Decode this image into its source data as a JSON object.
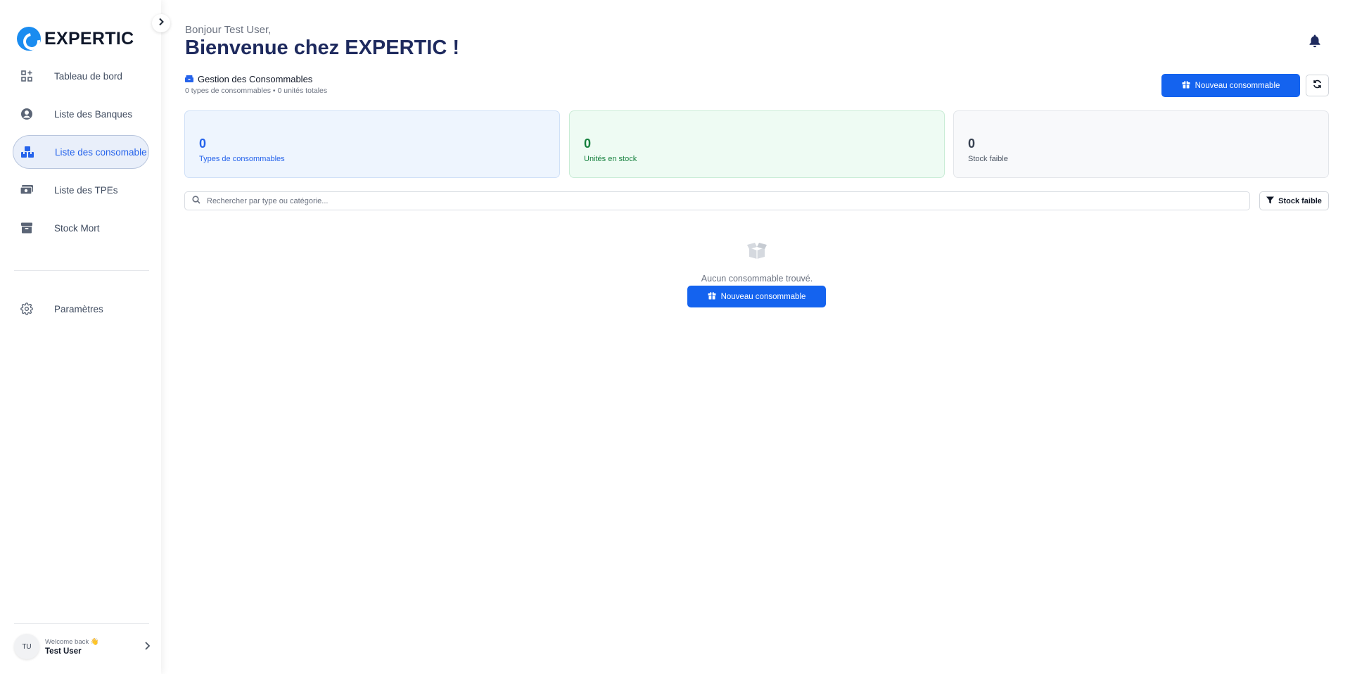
{
  "brand": {
    "name": "EXPERTIC",
    "color": "#1a8cf0"
  },
  "sidebar": {
    "collapse_icon": "chevron-right-icon",
    "items": [
      {
        "label": "Tableau de bord",
        "icon": "dashboard-grid-icon",
        "active": false
      },
      {
        "label": "Liste des Banques",
        "icon": "user-circle-icon",
        "active": false
      },
      {
        "label": "Liste des consomable",
        "icon": "boxes-icon",
        "active": true
      },
      {
        "label": "Liste des TPEs",
        "icon": "money-bill-icon",
        "active": false
      },
      {
        "label": "Stock Mort",
        "icon": "archive-icon",
        "active": false
      }
    ],
    "settings": {
      "label": "Paramètres",
      "icon": "gear-icon"
    },
    "user": {
      "initials": "TU",
      "welcome": "Welcome back 👋",
      "name": "Test User"
    }
  },
  "header": {
    "greeting": "Bonjour Test User,",
    "title": "Bienvenue chez EXPERTIC !",
    "notification_icon": "bell-icon"
  },
  "section": {
    "title": "Gestion des Consommables",
    "subtitle": "0 types de consommables • 0 unités totales",
    "new_button": "Nouveau consommable",
    "refresh_icon": "refresh-icon"
  },
  "stats": [
    {
      "value": "0",
      "label": "Types de consommables",
      "color": "#2563eb"
    },
    {
      "value": "0",
      "label": "Unités en stock",
      "color": "#15803d"
    },
    {
      "value": "0",
      "label": "Stock faible",
      "color": "#374151"
    }
  ],
  "search": {
    "placeholder": "Rechercher par type ou catégorie..."
  },
  "filter": {
    "label": "Stock faible"
  },
  "empty": {
    "message": "Aucun consommable trouvé.",
    "button": "Nouveau consommable"
  },
  "colors": {
    "primary": "#1463ef",
    "title": "#1e2a5e"
  }
}
